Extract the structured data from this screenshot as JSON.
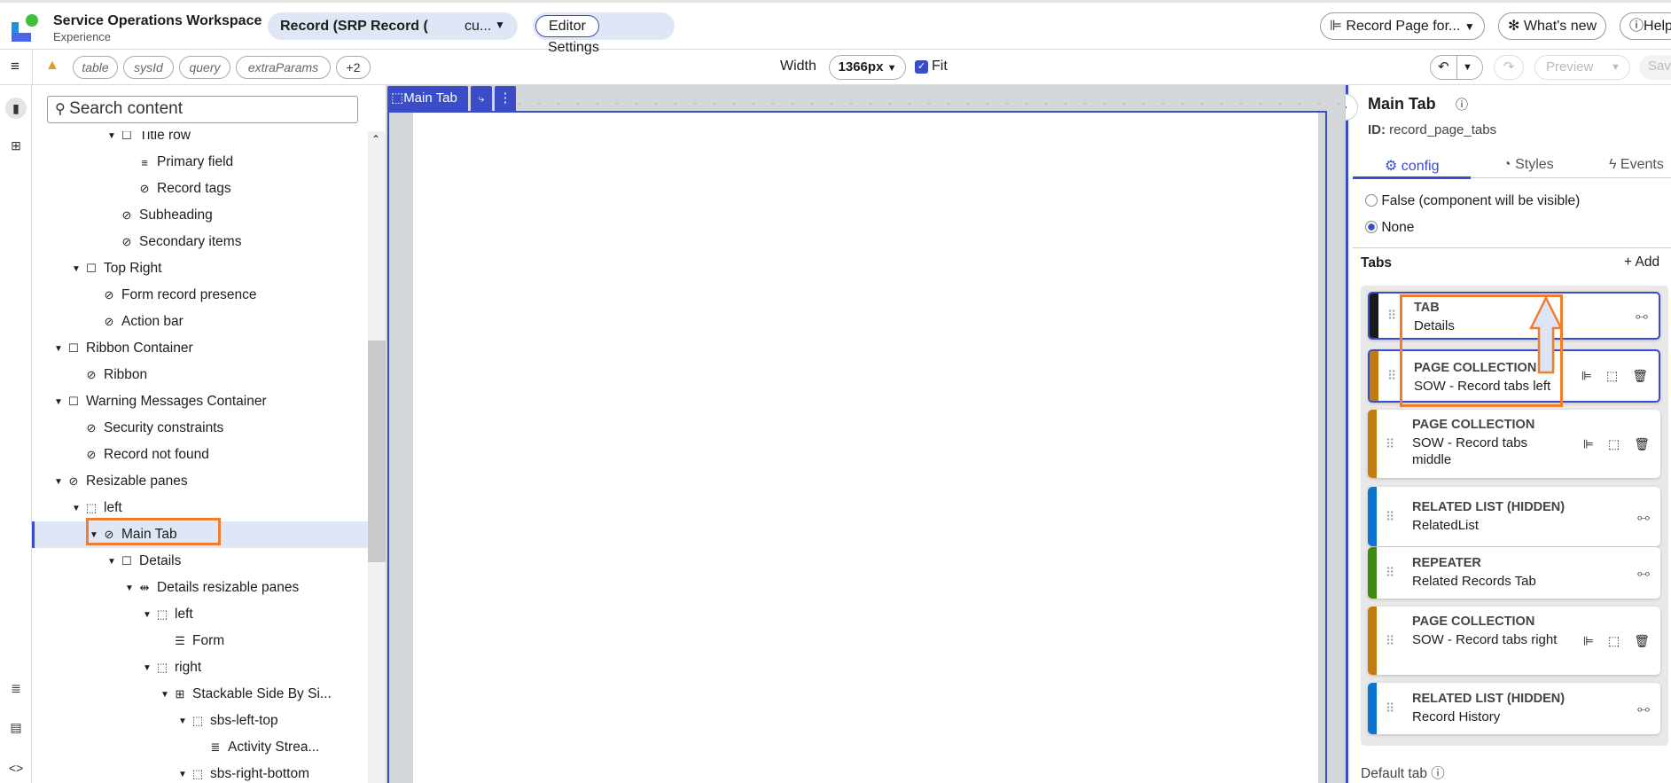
{
  "header": {
    "app_title": "Service Operations Workspace",
    "app_subtitle": "Experience",
    "record_selector": "Record (SRP Record (",
    "record_selector_suffix": "cu...",
    "modes": [
      "Editor",
      "Settings"
    ],
    "active_mode": "Editor",
    "record_page_button": "Record Page for...",
    "whats_new": "What's new",
    "help": "Help"
  },
  "toolbar": {
    "params": [
      "table",
      "sysId",
      "query",
      "extraParams"
    ],
    "more_params": "+2",
    "width_label": "Width",
    "width_value": "1366px",
    "fit_label": "Fit",
    "fit_checked": true,
    "preview": "Preview",
    "save": "Save"
  },
  "tree": {
    "search_placeholder": "Search content",
    "items": [
      {
        "label": "Title row",
        "level": 3,
        "icon": "container",
        "expanded": true
      },
      {
        "label": "Primary field",
        "level": 4,
        "icon": "text-lines"
      },
      {
        "label": "Record tags",
        "level": 4,
        "icon": "eye-slash"
      },
      {
        "label": "Subheading",
        "level": 3,
        "icon": "eye-slash"
      },
      {
        "label": "Secondary items",
        "level": 3,
        "icon": "eye-slash"
      },
      {
        "label": "Top Right",
        "level": 1,
        "icon": "container",
        "expanded": true
      },
      {
        "label": "Form record presence",
        "level": 2,
        "icon": "eye-slash"
      },
      {
        "label": "Action bar",
        "level": 2,
        "icon": "eye-slash"
      },
      {
        "label": "Ribbon Container",
        "level": 0,
        "icon": "container",
        "expanded": true
      },
      {
        "label": "Ribbon",
        "level": 1,
        "icon": "eye-slash"
      },
      {
        "label": "Warning Messages Container",
        "level": 0,
        "icon": "container",
        "expanded": true
      },
      {
        "label": "Security constraints",
        "level": 1,
        "icon": "eye-slash"
      },
      {
        "label": "Record not found",
        "level": 1,
        "icon": "eye-slash"
      },
      {
        "label": "Resizable panes",
        "level": 0,
        "icon": "eye-slash",
        "expanded": true
      },
      {
        "label": "left",
        "level": 1,
        "icon": "dashed-box",
        "expanded": true
      },
      {
        "label": "Main Tab",
        "level": 2,
        "icon": "eye-slash",
        "expanded": true,
        "selected": true
      },
      {
        "label": "Details",
        "level": 3,
        "icon": "container",
        "expanded": true
      },
      {
        "label": "Details resizable panes",
        "level": 4,
        "icon": "resize",
        "expanded": true
      },
      {
        "label": "left",
        "level": 5,
        "icon": "dashed-box",
        "expanded": true
      },
      {
        "label": "Form",
        "level": 6,
        "icon": "form"
      },
      {
        "label": "right",
        "level": 5,
        "icon": "dashed-box",
        "expanded": true
      },
      {
        "label": "Stackable Side By Si...",
        "level": 6,
        "icon": "stack",
        "expanded": true
      },
      {
        "label": "sbs-left-top",
        "level": 7,
        "icon": "dashed-box",
        "expanded": true
      },
      {
        "label": "Activity Strea...",
        "level": 8,
        "icon": "list"
      },
      {
        "label": "sbs-right-bottom",
        "level": 7,
        "icon": "dashed-box",
        "expanded": true
      }
    ]
  },
  "canvas": {
    "selected_label": "Main Tab"
  },
  "panel": {
    "title": "Main Tab",
    "id_label": "ID:",
    "id_value": "record_page_tabs",
    "tabs": [
      "config",
      "Styles",
      "Events"
    ],
    "active_tab": "config",
    "radio_options": [
      {
        "label": "False (component will be visible)",
        "checked": false
      },
      {
        "label": "None",
        "checked": true
      }
    ],
    "tabs_section": "Tabs",
    "add_label": "Add",
    "cards": [
      {
        "type": "TAB",
        "name": "Details",
        "color": "#1b1b1b",
        "actions": "settings",
        "selected": true
      },
      {
        "type": "PAGE COLLECTION",
        "name": "SOW - Record tabs left",
        "color": "#c47b0e",
        "actions": "collection",
        "selected": true
      },
      {
        "type": "PAGE COLLECTION",
        "name": "SOW - Record tabs middle",
        "color": "#c47b0e",
        "actions": "collection"
      },
      {
        "type": "RELATED LIST (HIDDEN)",
        "name": "RelatedList",
        "color": "#0a74d0",
        "actions": "settings"
      },
      {
        "type": "REPEATER",
        "name": "Related Records Tab",
        "color": "#3d8a12",
        "actions": "settings"
      },
      {
        "type": "PAGE COLLECTION",
        "name": "SOW - Record tabs right",
        "color": "#c47b0e",
        "actions": "collection"
      },
      {
        "type": "RELATED LIST (HIDDEN)",
        "name": "Record History",
        "color": "#0a74d0",
        "actions": "settings"
      }
    ],
    "default_tab_label": "Default tab"
  },
  "colors": {
    "accent": "#3b4cc8",
    "annotation": "#f07c2c",
    "selection_bg": "#dfe7f7"
  }
}
